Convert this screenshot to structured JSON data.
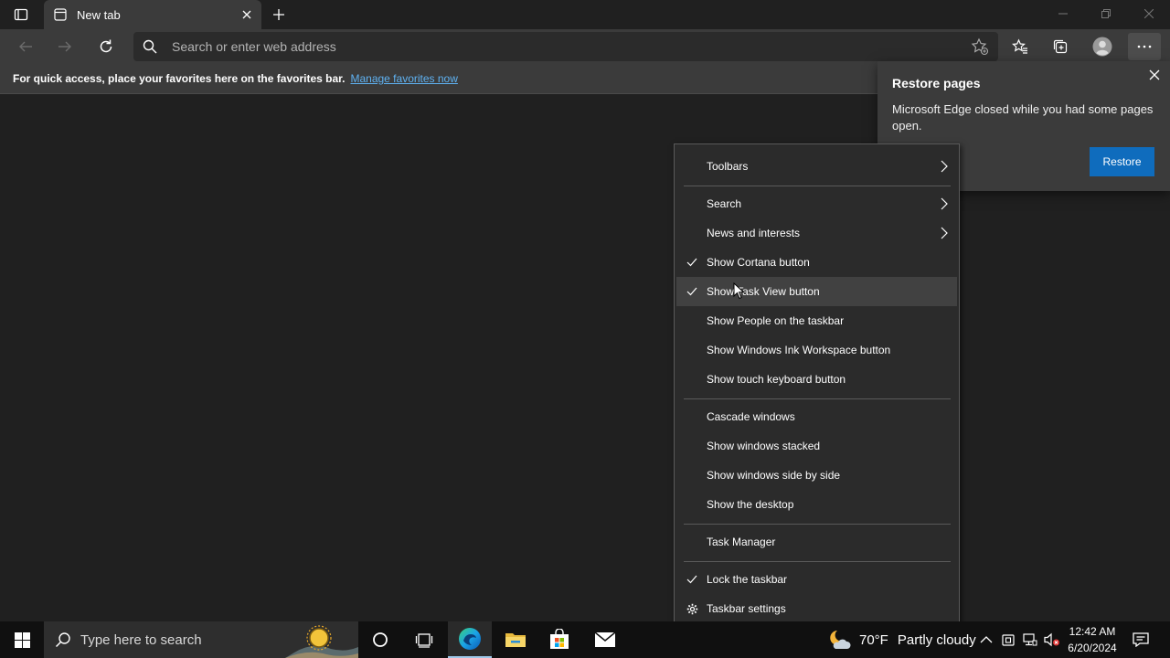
{
  "browser": {
    "tab_title": "New tab",
    "address_placeholder": "Search or enter web address"
  },
  "favorites_bar": {
    "message": "For quick access, place your favorites here on the favorites bar.",
    "link": "Manage favorites now"
  },
  "restore_popup": {
    "title": "Restore pages",
    "message": "Microsoft Edge closed while you had some pages open.",
    "button": "Restore"
  },
  "context_menu": {
    "items": [
      {
        "label": "Toolbars",
        "submenu": true
      },
      {
        "label": "Search",
        "submenu": true
      },
      {
        "label": "News and interests",
        "submenu": true
      },
      {
        "label": "Show Cortana button",
        "checked": true
      },
      {
        "label": "Show Task View button",
        "checked": true,
        "highlighted": true
      },
      {
        "label": "Show People on the taskbar"
      },
      {
        "label": "Show Windows Ink Workspace button"
      },
      {
        "label": "Show touch keyboard button"
      },
      {
        "label": "Cascade windows"
      },
      {
        "label": "Show windows stacked"
      },
      {
        "label": "Show windows side by side"
      },
      {
        "label": "Show the desktop"
      },
      {
        "label": "Task Manager"
      },
      {
        "label": "Lock the taskbar",
        "checked": true
      },
      {
        "label": "Taskbar settings",
        "icon": "gear-icon"
      }
    ]
  },
  "taskbar": {
    "search_placeholder": "Type here to search",
    "weather_temp": "70°F",
    "weather_condition": "Partly cloudy",
    "time": "12:42 AM",
    "date": "6/20/2024"
  },
  "colors": {
    "accent": "#0f6cbd",
    "link": "#5fb2f2",
    "menu_bg": "#2b2b2b",
    "taskbar_bg": "#101010"
  }
}
